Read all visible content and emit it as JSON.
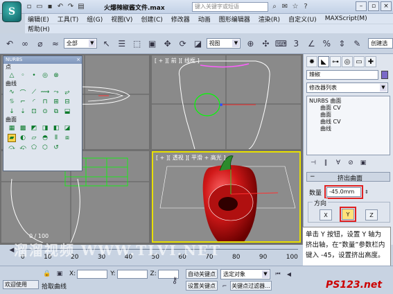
{
  "titlebar": {
    "doc_title": "火爆辣椒酱文件.max",
    "search_placeholder": "键入关键字或短语",
    "app_logo_letter": "S"
  },
  "menu": {
    "items": [
      "编辑(E)",
      "工具(T)",
      "组(G)",
      "视图(V)",
      "创建(C)",
      "修改器",
      "动画",
      "图形编辑器",
      "渲染(R)",
      "自定义(U)",
      "MAXScript(M)"
    ],
    "help": "帮助(H)"
  },
  "toolbar": {
    "filter_value": "全部",
    "refcoord_value": "视图",
    "create_selection_label": "创建选"
  },
  "viewports": {
    "top_left_label": "",
    "top_right_label": "[ + ][ 前 ][ 线框 ]",
    "bottom_right_label": "[ + ][ 透视 ][ 平滑 + 高光 ]",
    "frame_counter": "0 / 100"
  },
  "nurbs_panel": {
    "title": "NURBS",
    "sections": [
      "点",
      "曲线",
      "曲面"
    ]
  },
  "command_panel": {
    "object_name": "辣椒",
    "modifier_list": "修改器列表",
    "stack": [
      "NURBS 曲面",
      "曲面 CV",
      "曲面",
      "曲线 CV",
      "曲线"
    ],
    "rollout_title": "挤出曲面",
    "amount_label": "数量",
    "amount_value": "-45.0mm",
    "direction_label": "方向",
    "axis_x": "X",
    "axis_y": "Y",
    "axis_z": "Z",
    "colors": {
      "highlight_box": "#e02020",
      "selected_viewport": "#e8e000"
    }
  },
  "annotation": {
    "text": "单击 Y 按钮，设置 Y 轴为挤出轴，在“数量”参数栏内键入 -45，设置挤出高度。"
  },
  "timeline": {
    "ticks": [
      "0",
      "10",
      "20",
      "30",
      "40",
      "50",
      "60",
      "70",
      "80",
      "90",
      "100"
    ]
  },
  "status": {
    "welcome": "欢迎使用",
    "prompt": "拾取曲线",
    "x_label": "X:",
    "y_label": "Y:",
    "z_label": "Z:",
    "auto_key": "自动关键点",
    "set_key": "设置关键点",
    "selected_object": "选定对象",
    "key_filters": "关键点过滤器..."
  },
  "watermarks": {
    "site1": "溜溜视频 WWW.TLVI.NET",
    "site2": "PS123.net"
  }
}
